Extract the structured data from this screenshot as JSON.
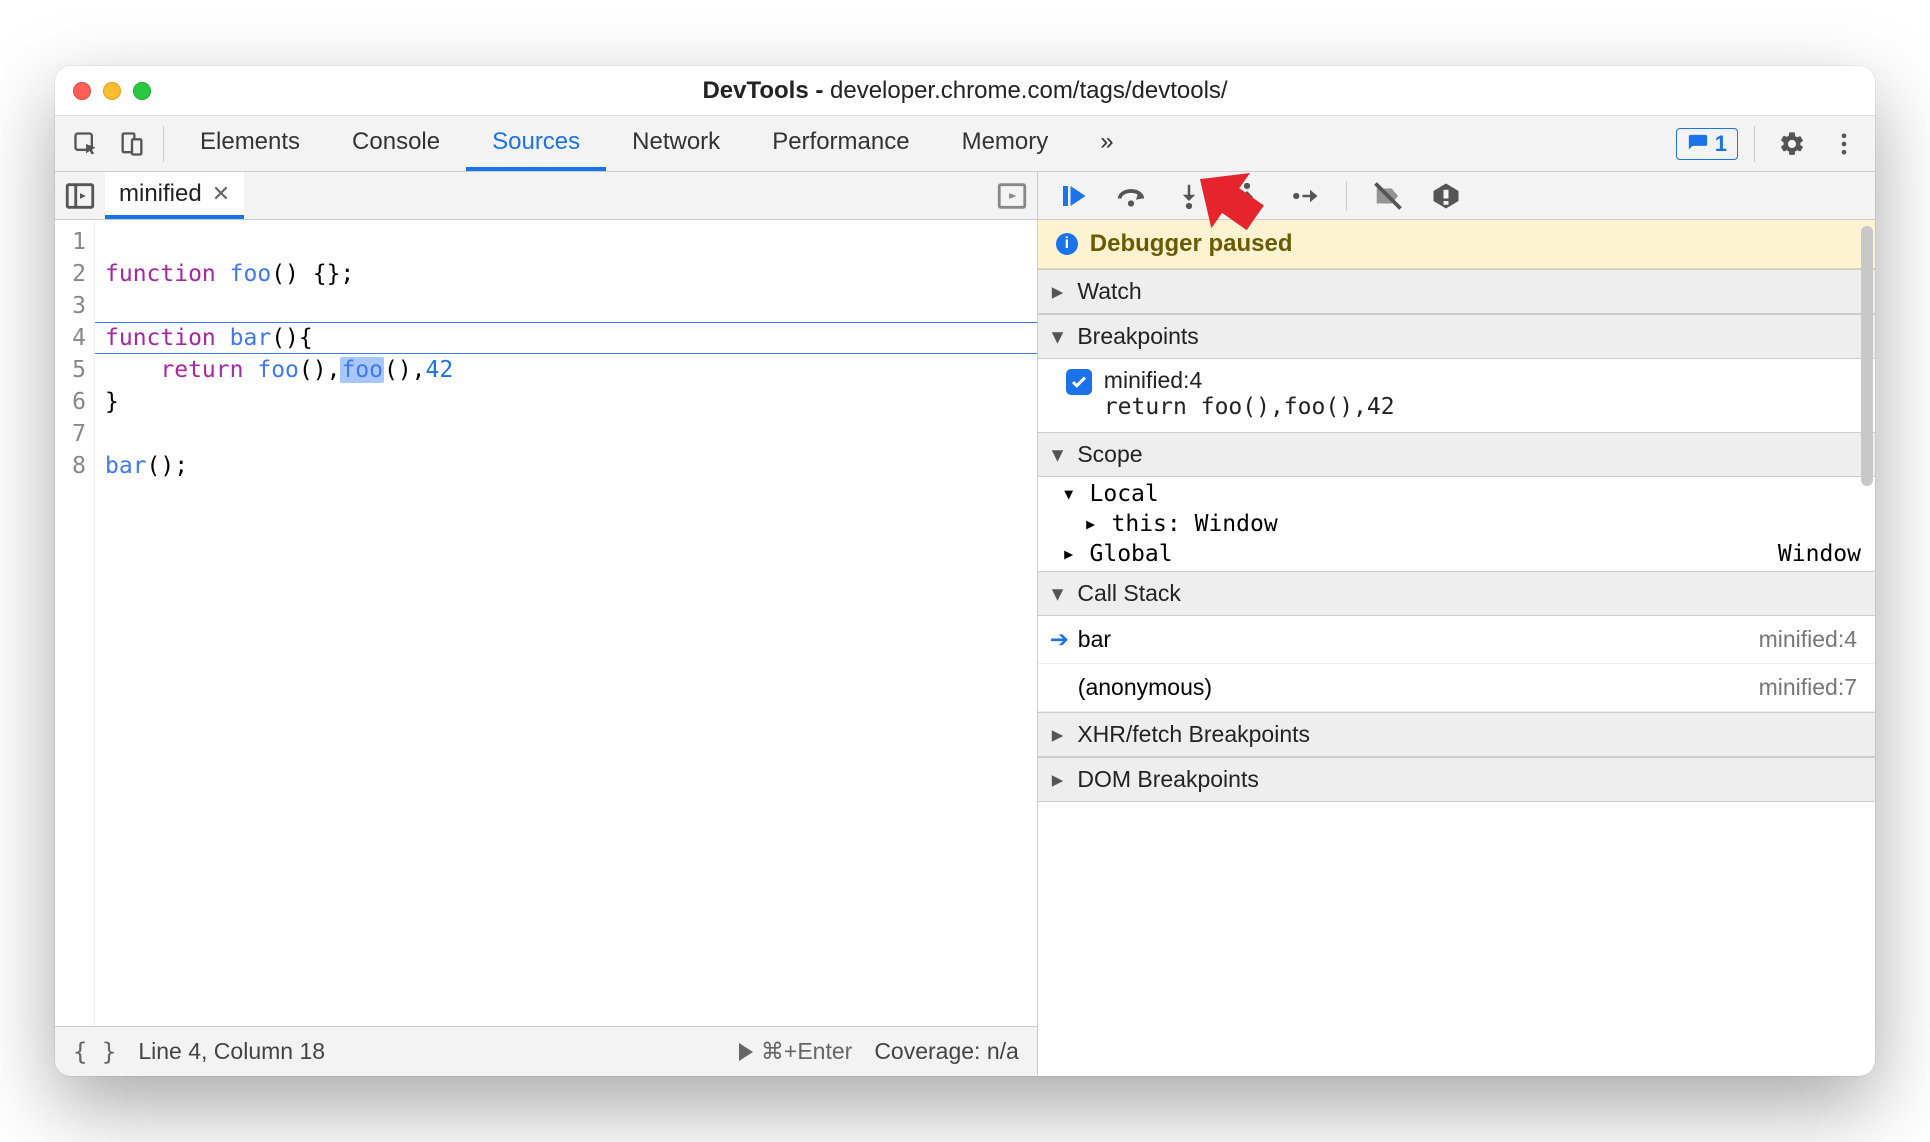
{
  "window": {
    "title_prefix": "DevTools - ",
    "title_host": "developer.chrome.com/tags/devtools/"
  },
  "tabs": {
    "items": [
      "Elements",
      "Console",
      "Sources",
      "Network",
      "Performance",
      "Memory"
    ],
    "active": "Sources",
    "overflow_glyph": "»",
    "issues_count": "1"
  },
  "editor": {
    "file_tab": "minified",
    "line_numbers": [
      "1",
      "2",
      "3",
      "4",
      "5",
      "6",
      "7",
      "8"
    ],
    "code_lines": {
      "l1": {
        "kw": "function",
        "fn": "foo",
        "rest": "() {};"
      },
      "l3": {
        "kw": "function",
        "fn": "bar",
        "rest": "(){"
      },
      "l4": {
        "kw": "return",
        "fn1": "foo",
        "mid": "(),",
        "fn2_hl": "foo",
        "tail": "(),",
        "num": "42"
      },
      "l5": "}",
      "l7": {
        "fn": "bar",
        "rest": "();"
      }
    },
    "status": {
      "pos": "Line 4, Column 18",
      "run": "⌘+Enter",
      "coverage": "Coverage: n/a"
    }
  },
  "debugger": {
    "paused_label": "Debugger paused",
    "sections": {
      "watch": "Watch",
      "breakpoints": "Breakpoints",
      "scope": "Scope",
      "callstack": "Call Stack",
      "xhr": "XHR/fetch Breakpoints",
      "dom": "DOM Breakpoints"
    },
    "breakpoint": {
      "label": "minified:4",
      "snippet": "return foo(),foo(),42"
    },
    "scope": {
      "local_label": "Local",
      "this_key": "this",
      "this_val": "Window",
      "global_label": "Global",
      "global_val": "Window"
    },
    "callstack": [
      {
        "fn": "bar",
        "loc": "minified:4",
        "current": true
      },
      {
        "fn": "(anonymous)",
        "loc": "minified:7",
        "current": false
      }
    ]
  }
}
